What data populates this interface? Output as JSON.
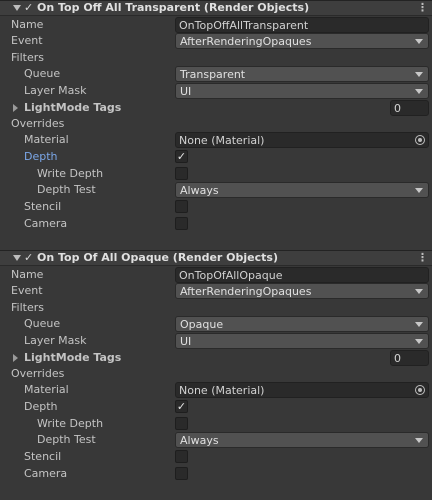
{
  "features": [
    {
      "title": "On Top Off All Transparent (Render Objects)",
      "enabled_mark": "✓",
      "menu_icon": "⋮",
      "name_label": "Name",
      "name_value": "OnTopOffAllTransparent",
      "event_label": "Event",
      "event_value": "AfterRenderingOpaques",
      "filters_label": "Filters",
      "queue_label": "Queue",
      "queue_value": "Transparent",
      "layer_mask_label": "Layer Mask",
      "layer_mask_value": "UI",
      "lightmode_label": "LightMode Tags",
      "lightmode_value": "0",
      "overrides_label": "Overrides",
      "material_label": "Material",
      "material_value": "None (Material)",
      "depth_label": "Depth",
      "depth_checked": "✓",
      "write_depth_label": "Write Depth",
      "depth_test_label": "Depth Test",
      "depth_test_value": "Always",
      "stencil_label": "Stencil",
      "camera_label": "Camera"
    },
    {
      "title": "On Top Of All Opaque (Render Objects)",
      "enabled_mark": "✓",
      "menu_icon": "⋮",
      "name_label": "Name",
      "name_value": "OnTopOfAllOpaque",
      "event_label": "Event",
      "event_value": "AfterRenderingOpaques",
      "filters_label": "Filters",
      "queue_label": "Queue",
      "queue_value": "Opaque",
      "layer_mask_label": "Layer Mask",
      "layer_mask_value": "UI",
      "lightmode_label": "LightMode Tags",
      "lightmode_value": "0",
      "overrides_label": "Overrides",
      "material_label": "Material",
      "material_value": "None (Material)",
      "depth_label": "Depth",
      "depth_checked": "✓",
      "write_depth_label": "Write Depth",
      "depth_test_label": "Depth Test",
      "depth_test_value": "Always",
      "stencil_label": "Stencil",
      "camera_label": "Camera"
    }
  ],
  "colors": {
    "background": "#383838",
    "highlight_label": "#7ba7e8"
  }
}
